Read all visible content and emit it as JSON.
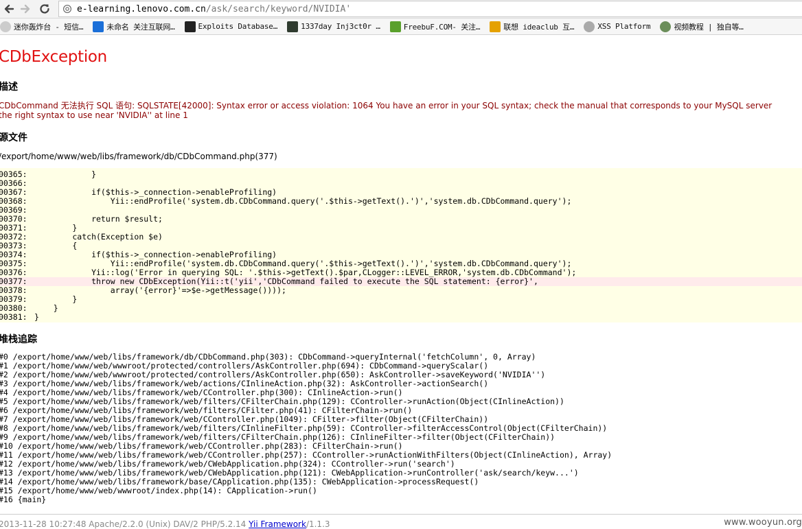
{
  "browser": {
    "url_host": "e-learning.lenovo.com.cn",
    "url_path": "/ask/search/keyword/NVIDIA'",
    "bookmarks": [
      {
        "label": "迷你轰炸台 - 短信…",
        "icon": "skull-icon",
        "color": "#cccccc"
      },
      {
        "label": "未命名 关注互联网…",
        "icon": "mb-icon",
        "color": "#1b6fd8"
      },
      {
        "label": "Exploits Database…",
        "icon": "exploit-db-icon",
        "color": "#222222"
      },
      {
        "label": "1337day Inj3ct0r …",
        "icon": "1337day-icon",
        "color": "#2f3b2f"
      },
      {
        "label": "FreebuF.COM- 关注…",
        "icon": "freebuf-icon",
        "color": "#5aa02c"
      },
      {
        "label": "联想 ideaclub 互…",
        "icon": "lenovo-grid-icon",
        "color": "#e5a100"
      },
      {
        "label": "XSS Platform",
        "icon": "globe-icon",
        "color": "#aaaaaa"
      },
      {
        "label": "视频教程 | 独自等…",
        "icon": "avatar-icon",
        "color": "#6b8e5a"
      }
    ]
  },
  "page": {
    "title": "CDbException",
    "description_heading": "描述",
    "description_line1": "CDbCommand 无法执行 SQL 语句: SQLSTATE[42000]: Syntax error or access violation: 1064 You have an error in your SQL syntax; check the manual that corresponds to your MySQL server",
    "description_line2": "the right syntax to use near 'NVIDIA'' at line 1",
    "source_heading": "源文件",
    "source_path": "/export/home/www/web/libs/framework/db/CDbCommand.php(377)",
    "code_lines": [
      {
        "num": "00365:",
        "code": "            }",
        "error": false
      },
      {
        "num": "00366:",
        "code": "",
        "error": false
      },
      {
        "num": "00367:",
        "code": "            if($this->_connection->enableProfiling)",
        "error": false
      },
      {
        "num": "00368:",
        "code": "                Yii::endProfile('system.db.CDbCommand.query('.$this->getText().')','system.db.CDbCommand.query');",
        "error": false
      },
      {
        "num": "00369:",
        "code": "",
        "error": false
      },
      {
        "num": "00370:",
        "code": "            return $result;",
        "error": false
      },
      {
        "num": "00371:",
        "code": "        }",
        "error": false
      },
      {
        "num": "00372:",
        "code": "        catch(Exception $e)",
        "error": false
      },
      {
        "num": "00373:",
        "code": "        {",
        "error": false
      },
      {
        "num": "00374:",
        "code": "            if($this->_connection->enableProfiling)",
        "error": false
      },
      {
        "num": "00375:",
        "code": "                Yii::endProfile('system.db.CDbCommand.query('.$this->getText().')','system.db.CDbCommand.query');",
        "error": false
      },
      {
        "num": "00376:",
        "code": "            Yii::log('Error in querying SQL: '.$this->getText().$par,CLogger::LEVEL_ERROR,'system.db.CDbCommand');",
        "error": false
      },
      {
        "num": "00377:",
        "code": "            throw new CDbException(Yii::t('yii','CDbCommand failed to execute the SQL statement: {error}',",
        "error": true
      },
      {
        "num": "00378:",
        "code": "                array('{error}'=>$e->getMessage())));",
        "error": false
      },
      {
        "num": "00379:",
        "code": "        }",
        "error": false
      },
      {
        "num": "00380:",
        "code": "    }",
        "error": false
      },
      {
        "num": "00381:",
        "code": "}",
        "error": false
      }
    ],
    "stack_heading": "堆栈追踪",
    "stack_trace": [
      "#0 /export/home/www/web/libs/framework/db/CDbCommand.php(303): CDbCommand->queryInternal('fetchColumn', 0, Array)",
      "#1 /export/home/www/web/wwwroot/protected/controllers/AskController.php(694): CDbCommand->queryScalar()",
      "#2 /export/home/www/web/wwwroot/protected/controllers/AskController.php(650): AskController->saveKeyword('NVIDIA'')",
      "#3 /export/home/www/web/libs/framework/web/actions/CInlineAction.php(32): AskController->actionSearch()",
      "#4 /export/home/www/web/libs/framework/web/CController.php(300): CInlineAction->run()",
      "#5 /export/home/www/web/libs/framework/web/filters/CFilterChain.php(129): CController->runAction(Object(CInlineAction))",
      "#6 /export/home/www/web/libs/framework/web/filters/CFilter.php(41): CFilterChain->run()",
      "#7 /export/home/www/web/libs/framework/web/CController.php(1049): CFilter->filter(Object(CFilterChain))",
      "#8 /export/home/www/web/libs/framework/web/filters/CInlineFilter.php(59): CController->filterAccessControl(Object(CFilterChain))",
      "#9 /export/home/www/web/libs/framework/web/filters/CFilterChain.php(126): CInlineFilter->filter(Object(CFilterChain))",
      "#10 /export/home/www/web/libs/framework/web/CController.php(283): CFilterChain->run()",
      "#11 /export/home/www/web/libs/framework/web/CController.php(257): CController->runActionWithFilters(Object(CInlineAction), Array)",
      "#12 /export/home/www/web/libs/framework/web/CWebApplication.php(324): CController->run('search')",
      "#13 /export/home/www/web/libs/framework/web/CWebApplication.php(121): CWebApplication->runController('ask/search/keyw...')",
      "#14 /export/home/www/web/libs/framework/base/CApplication.php(135): CWebApplication->processRequest()",
      "#15 /export/home/www/web/wwwroot/index.php(14): CApplication->run()",
      "#16 {main}"
    ],
    "footer_prefix": "2013-11-28 10:27:48 Apache/2.2.0 (Unix) DAV/2 PHP/5.2.14 ",
    "footer_link": "Yii Framework",
    "footer_suffix": "/1.1.3",
    "watermark": "www.wooyun.org"
  }
}
